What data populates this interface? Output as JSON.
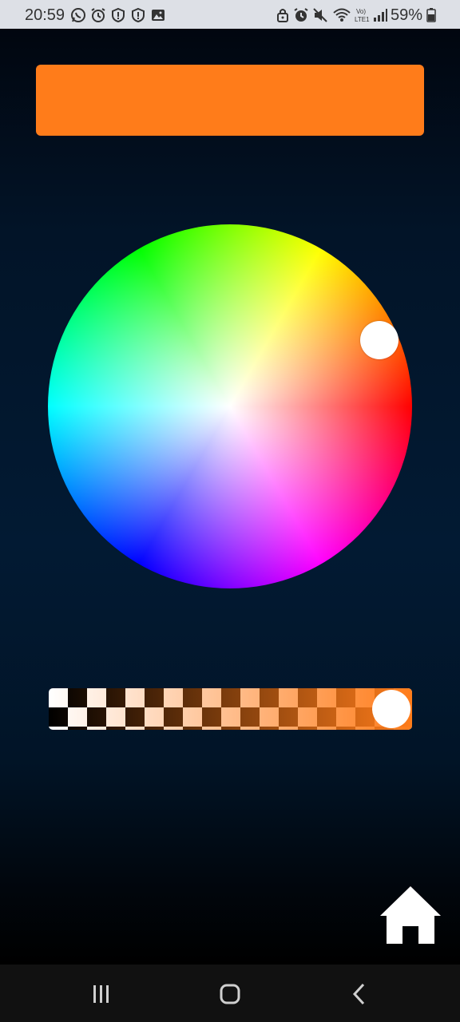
{
  "status_bar": {
    "time": "20:59",
    "battery": "59%",
    "left_icons": [
      "whatsapp-icon",
      "alarm-icon",
      "shield-icon",
      "shield-icon",
      "image-icon"
    ],
    "right_icons": [
      "lock-icon",
      "alarm-icon",
      "mute-icon",
      "wifi-icon",
      "volte-icon",
      "signal-icon",
      "battery-icon"
    ]
  },
  "color_picker": {
    "selected_color": "#ff7c1a",
    "hue_degrees": 24,
    "saturation": 0.9,
    "alpha": 1.0,
    "alpha_start_color": "rgba(255,124,26,0)",
    "alpha_end_color": "#ff7c1a"
  },
  "home_button": {
    "icon": "home-icon",
    "color": "#ffffff"
  },
  "nav_bar": {
    "icons": [
      "recents-icon",
      "home-nav-icon",
      "back-icon"
    ],
    "color": "#cfcfcf"
  }
}
